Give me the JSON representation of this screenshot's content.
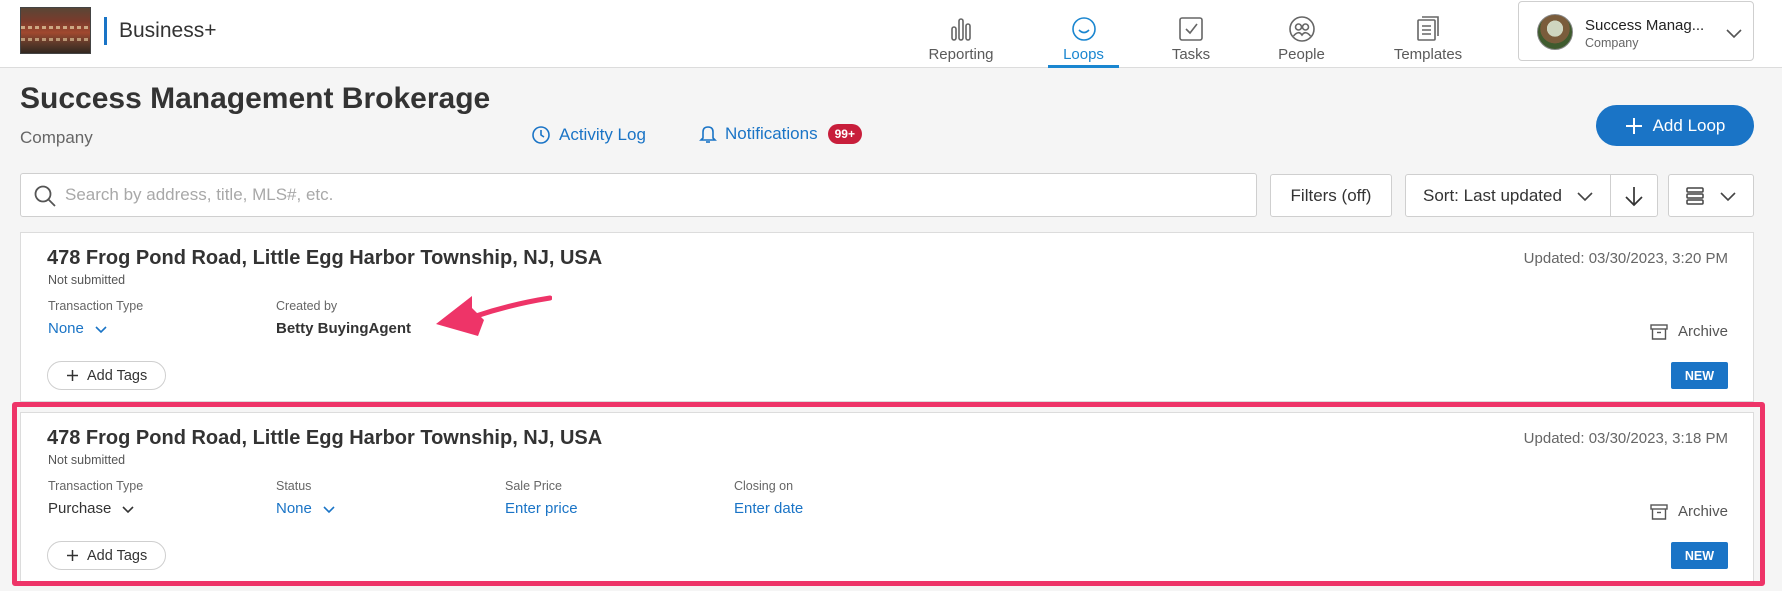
{
  "app": {
    "brand": "Business+"
  },
  "nav": {
    "items": [
      {
        "label": "Reporting",
        "icon": "bar-chart-icon",
        "active": false
      },
      {
        "label": "Loops",
        "icon": "loop-icon",
        "active": true
      },
      {
        "label": "Tasks",
        "icon": "checkbox-icon",
        "active": false
      },
      {
        "label": "People",
        "icon": "people-icon",
        "active": false
      },
      {
        "label": "Templates",
        "icon": "templates-icon",
        "active": false
      }
    ]
  },
  "account": {
    "name": "Success Manag...",
    "type": "Company"
  },
  "header": {
    "title": "Success Management Brokerage",
    "subtitle": "Company",
    "activity_log": "Activity Log",
    "notifications": "Notifications",
    "notifications_badge": "99+",
    "add_loop": "Add Loop"
  },
  "toolbar": {
    "search_placeholder": "Search by address, title, MLS#, etc.",
    "filters": "Filters (off)",
    "sort": "Sort: Last updated"
  },
  "loops": [
    {
      "title": "478 Frog Pond Road, Little Egg Harbor Township, NJ, USA",
      "status": "Not submitted",
      "updated": "Updated: 03/30/2023, 3:20 PM",
      "transaction_type_label": "Transaction Type",
      "transaction_type_value": "None",
      "created_by_label": "Created by",
      "created_by_value": "Betty BuyingAgent",
      "add_tags": "Add Tags",
      "archive": "Archive",
      "badge": "NEW"
    },
    {
      "title": "478 Frog Pond Road, Little Egg Harbor Township, NJ, USA",
      "status": "Not submitted",
      "updated": "Updated: 03/30/2023, 3:18 PM",
      "transaction_type_label": "Transaction Type",
      "transaction_type_value": "Purchase",
      "status_label": "Status",
      "status_value": "None",
      "sale_price_label": "Sale Price",
      "sale_price_value": "Enter price",
      "closing_label": "Closing on",
      "closing_value": "Enter date",
      "add_tags": "Add Tags",
      "archive": "Archive",
      "badge": "NEW"
    }
  ],
  "colors": {
    "accent": "#1a74c6",
    "highlight": "#ee3468",
    "badge": "#c81e3b"
  }
}
